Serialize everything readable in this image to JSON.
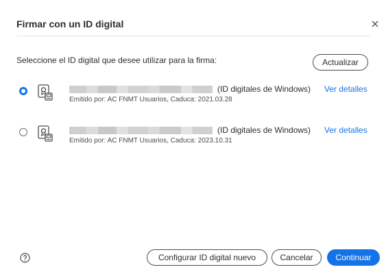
{
  "dialog": {
    "title": "Firmar con un ID digital",
    "close_icon": "close-icon",
    "prompt": "Seleccione el ID digital que desee utilizar para la firma:",
    "refresh_label": "Actualizar"
  },
  "ids": [
    {
      "selected": true,
      "type_label": "(ID digitales de Windows)",
      "details_label": "Ver detalles",
      "issued_text": "Emitido por: AC FNMT Usuarios, Caduca: 2021.03.28",
      "icon": "certificate-icon"
    },
    {
      "selected": false,
      "type_label": "(ID digitales de Windows)",
      "details_label": "Ver detalles",
      "issued_text": "Emitido por: AC FNMT Usuarios, Caduca: 2023.10.31",
      "icon": "certificate-icon"
    }
  ],
  "footer": {
    "help_icon": "help-icon",
    "configure_label": "Configurar ID digital nuevo",
    "cancel_label": "Cancelar",
    "continue_label": "Continuar"
  },
  "colors": {
    "accent": "#1473e6"
  }
}
